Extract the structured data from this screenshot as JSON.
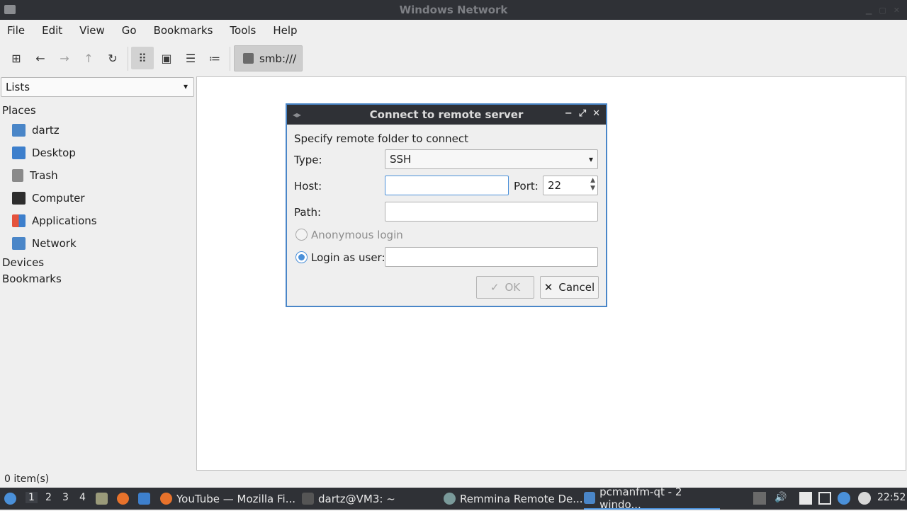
{
  "window": {
    "title": "Windows Network"
  },
  "menu": [
    "File",
    "Edit",
    "View",
    "Go",
    "Bookmarks",
    "Tools",
    "Help"
  ],
  "toolbar": {
    "path": "smb:///",
    "icons": [
      "new-tab-icon",
      "back-icon",
      "forward-icon",
      "up-icon",
      "reload-icon",
      "icon-view-icon",
      "thumbnail-view-icon",
      "compact-view-icon",
      "detailed-list-icon"
    ]
  },
  "sidebar": {
    "selector": "Lists",
    "places_label": "Places",
    "places": [
      {
        "label": "dartz",
        "icon": "home-folder-icon",
        "color": "#4a86c8"
      },
      {
        "label": "Desktop",
        "icon": "desktop-icon",
        "color": "#3d7fcc"
      },
      {
        "label": "Trash",
        "icon": "trash-icon",
        "color": "#8a8a8a"
      },
      {
        "label": "Computer",
        "icon": "computer-icon",
        "color": "#2d2d2d"
      },
      {
        "label": "Applications",
        "icon": "applications-icon",
        "color": "#e5533d"
      },
      {
        "label": "Network",
        "icon": "network-folder-icon",
        "color": "#4a86c8"
      }
    ],
    "devices_label": "Devices",
    "bookmarks_label": "Bookmarks"
  },
  "status": {
    "items": "0 item(s)"
  },
  "dialog": {
    "title": "Connect to remote server",
    "heading": "Specify remote folder to connect",
    "type_label": "Type:",
    "type_value": "SSH",
    "host_label": "Host:",
    "host_value": "",
    "port_label": "Port:",
    "port_value": "22",
    "path_label": "Path:",
    "path_value": "",
    "anon_label": "Anonymous login",
    "user_label": "Login as user:",
    "user_value": "",
    "ok_label": "OK",
    "cancel_label": "Cancel"
  },
  "taskbar": {
    "desktops": [
      "1",
      "2",
      "3",
      "4"
    ],
    "tasks": [
      {
        "label": "YouTube — Mozilla Fi...",
        "icon": "firefox-icon"
      },
      {
        "label": "dartz@VM3: ~",
        "icon": "terminal-icon"
      },
      {
        "label": "Remmina Remote De...",
        "icon": "remmina-icon"
      },
      {
        "label": "pcmanfm-qt - 2 windo...",
        "icon": "folder-icon"
      }
    ],
    "clock": "22:52"
  }
}
